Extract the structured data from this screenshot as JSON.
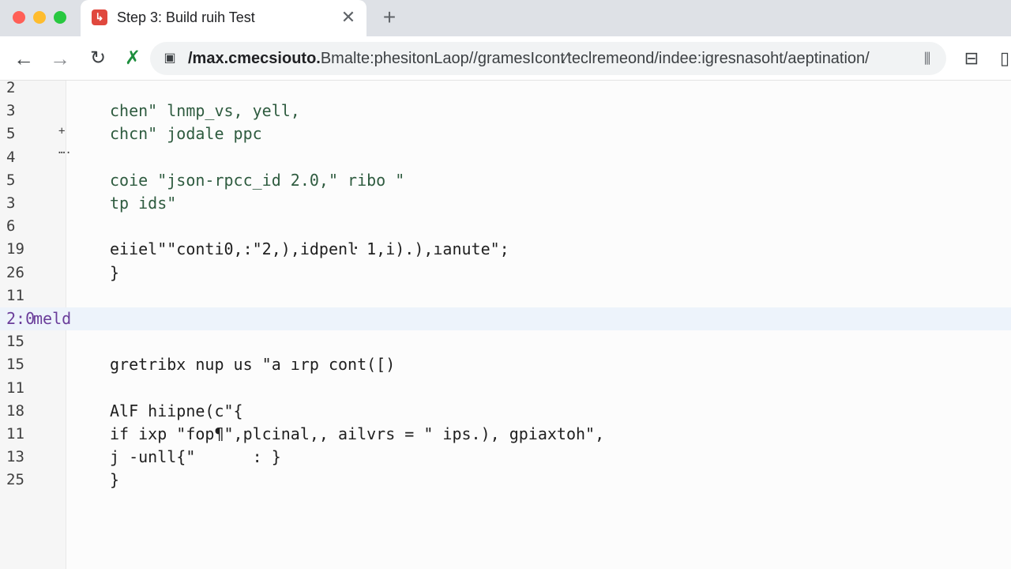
{
  "tab": {
    "title": "Step 3: Build ruih Test",
    "favicon_glyph": "↳",
    "close_glyph": "✕",
    "new_tab_glyph": "+"
  },
  "toolbar": {
    "back_glyph": "←",
    "forward_glyph": "→",
    "reload_glyph": "↻",
    "extension_glyph": "✗",
    "site_icon_glyph": "▣",
    "url_host": "/max.cmecsiouto.",
    "url_path": "Bmalte:phesitonLaop//gramesIcont∕teclremeond/indee:igresnasoht/aeptination/",
    "omnibox_action_glyph": "⫼",
    "right_btn1_glyph": "⊟",
    "right_btn2_glyph": "▯"
  },
  "editor": {
    "gutter_marks": [
      "+",
      "…."
    ],
    "highlighted_line": {
      "number": "2:0",
      "text": "meld"
    },
    "lines": [
      {
        "n": "2",
        "text": ""
      },
      {
        "n": "3",
        "text": "chen\" lnmp_vs, yell,"
      },
      {
        "n": "5",
        "text": "chcn\" jodale ppc"
      },
      {
        "n": "4",
        "text": ""
      },
      {
        "n": "5",
        "text": "coie \"json-rpcc_id 2.0,\" ribo \""
      },
      {
        "n": "3",
        "text": "tp ids\""
      },
      {
        "n": "6",
        "text": ""
      },
      {
        "n": "19",
        "text": "eiiel\"\"conti0,:\"2,),idpenŀ 1,i).),ıanute\";"
      },
      {
        "n": "26",
        "text": "}"
      },
      {
        "n": "11",
        "text": ""
      },
      {
        "n": "15",
        "text": ""
      },
      {
        "n": "15",
        "text": "gretribx nup us \"a ırp cont([)"
      },
      {
        "n": "11",
        "text": ""
      },
      {
        "n": "18",
        "text": "AlF hiipne(c\"{"
      },
      {
        "n": "11",
        "text": "if ixp \"fop¶\",plcinal,, ailvrs = \" ips.), gpiaxtoh\","
      },
      {
        "n": "13",
        "text": "j -unll{\"      : }"
      },
      {
        "n": "25",
        "text": "}"
      }
    ]
  },
  "colors": {
    "tabstrip": "#dee1e6",
    "highlight_row": "#edf3fb",
    "code_green": "#2e5b3f",
    "highlight_label": "#6a3d9a"
  }
}
